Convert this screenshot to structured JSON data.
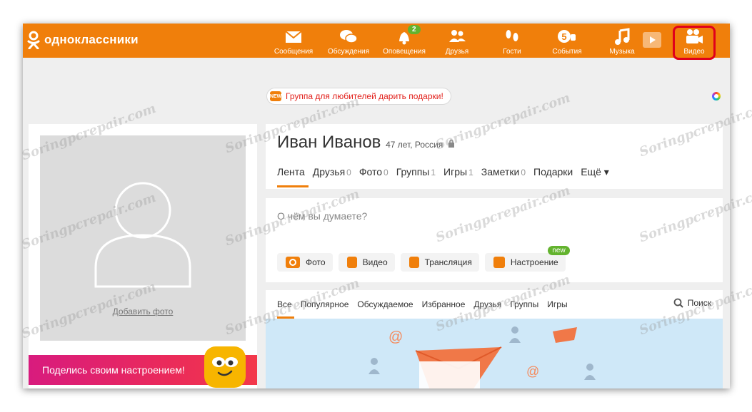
{
  "app": {
    "logo_text": "одноклассники"
  },
  "nav": [
    {
      "id": "messages",
      "label": "Сообщения",
      "icon": "envelope-icon"
    },
    {
      "id": "discussions",
      "label": "Обсуждения",
      "icon": "chat-bubbles-icon"
    },
    {
      "id": "notifications",
      "label": "Оповещения",
      "icon": "bell-icon",
      "badge": "2"
    },
    {
      "id": "friends",
      "label": "Друзья",
      "icon": "people-icon"
    },
    {
      "id": "guests",
      "label": "Гости",
      "icon": "footprints-icon"
    },
    {
      "id": "events",
      "label": "События",
      "icon": "five-plus-icon"
    },
    {
      "id": "music",
      "label": "Музыка",
      "icon": "music-note-icon"
    },
    {
      "id": "video",
      "label": "Видео",
      "icon": "video-camera-icon"
    }
  ],
  "promo": {
    "badge_text": "NEW",
    "text": "Группа для любителей дарить подарки!"
  },
  "left": {
    "add_photo": "Добавить фото",
    "mood_text": "Поделись своим настроением!"
  },
  "profile": {
    "name": "Иван Иванов",
    "meta": "47 лет, Россия",
    "tabs": [
      {
        "label": "Лента",
        "count": ""
      },
      {
        "label": "Друзья",
        "count": "0"
      },
      {
        "label": "Фото",
        "count": "0"
      },
      {
        "label": "Группы",
        "count": "1"
      },
      {
        "label": "Игры",
        "count": "1"
      },
      {
        "label": "Заметки",
        "count": "0"
      },
      {
        "label": "Подарки",
        "count": ""
      },
      {
        "label": "Ещё ▾",
        "count": ""
      }
    ]
  },
  "status": {
    "placeholder": "О чём вы думаете?",
    "buttons": [
      {
        "label": "Фото",
        "icon": "camera-icon"
      },
      {
        "label": "Видео",
        "icon": "video-camera-icon"
      },
      {
        "label": "Трансляция",
        "icon": "broadcast-camera-icon"
      },
      {
        "label": "Настроение",
        "icon": "smile-icon",
        "badge": "new"
      }
    ]
  },
  "feed": {
    "tabs": [
      "Все",
      "Популярное",
      "Обсуждаемое",
      "Избранное",
      "Друзья",
      "Группы",
      "Игры"
    ],
    "search": "Поиск"
  },
  "watermark": "Soringpcrepair.com",
  "colors": {
    "brand": "#f07f0b",
    "badge_green": "#63b32e",
    "highlight": "#e0001b"
  }
}
